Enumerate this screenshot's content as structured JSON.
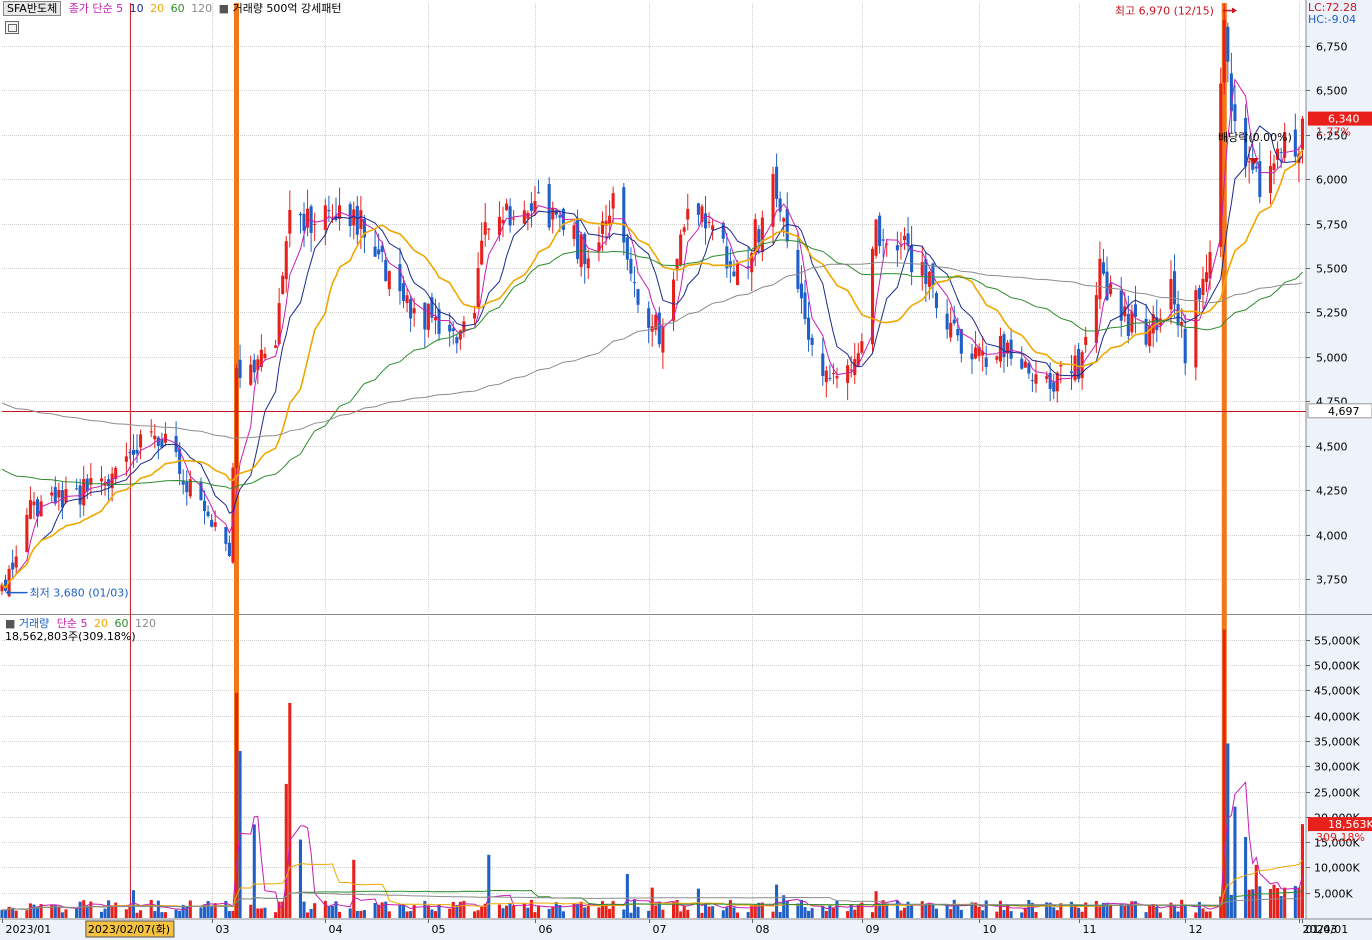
{
  "header": {
    "symbol": "SFA반도체",
    "ma_title": "종가 단순",
    "ma_periods": [
      "5",
      "10",
      "20",
      "60",
      "120"
    ],
    "volume_pattern": "거래량 500억 강세패턴",
    "lc": "LC:72.28",
    "hc": "HC:-9.04"
  },
  "volume_header": {
    "title": "거래량",
    "ma_title": "단순",
    "ma_periods": [
      "5",
      "20",
      "60",
      "120"
    ],
    "readout": "18,562,803주(309.18%)"
  },
  "annotations": {
    "high": "최고 6,970 (12/15)",
    "low": "최저 3,680 (01/03)",
    "dividend": "배당락(0.00%)",
    "last_price": "6,340",
    "last_pct": "1.77%",
    "ref_price": "4,697",
    "last_volume": "18,563K",
    "last_volume_pct": "309.18%",
    "selected_date": "2023/02/07(화)"
  },
  "colors": {
    "up": "#e8201c",
    "down": "#1f5fc8",
    "ma5": "#c81eb4",
    "ma10": "#1c2a8c",
    "ma20": "#f0a800",
    "ma60": "#2e8c2e",
    "ma120": "#8c8c8c",
    "event_bar": "#f07818",
    "ref_line": "#c8141e"
  },
  "chart_data": [
    {
      "type": "candlestick",
      "title": "SFA반도체",
      "x_ticks": [
        {
          "label": "2023/01",
          "date": "2023-01-02"
        },
        {
          "label": "03",
          "date": "2023-03-02"
        },
        {
          "label": "04",
          "date": "2023-04-03"
        },
        {
          "label": "05",
          "date": "2023-05-02"
        },
        {
          "label": "06",
          "date": "2023-06-01"
        },
        {
          "label": "07",
          "date": "2023-07-03"
        },
        {
          "label": "08",
          "date": "2023-08-01"
        },
        {
          "label": "09",
          "date": "2023-09-01"
        },
        {
          "label": "10",
          "date": "2023-10-04"
        },
        {
          "label": "11",
          "date": "2023-11-01"
        },
        {
          "label": "12",
          "date": "2023-12-01"
        },
        {
          "label": "2024/01",
          "date": "2024-01-02"
        },
        {
          "label": "01/03",
          "date": "2024-01-03"
        }
      ],
      "y_ticks": [
        3750,
        4000,
        4250,
        4500,
        4750,
        5000,
        5250,
        5500,
        5750,
        6000,
        6250,
        6500,
        6750
      ],
      "ylim": [
        3560,
        6990
      ],
      "x_range": [
        "2023-01-02",
        "2024-01-04"
      ],
      "series": [
        {
          "name": "종가",
          "close_points": [
            [
              "2023-01-03",
              3700
            ],
            [
              "2023-01-10",
              4150
            ],
            [
              "2023-01-20",
              4220
            ],
            [
              "2023-01-31",
              4280
            ],
            [
              "2023-02-07",
              4460
            ],
            [
              "2023-02-14",
              4610
            ],
            [
              "2023-02-17",
              4510
            ],
            [
              "2023-02-24",
              4280
            ],
            [
              "2023-03-03",
              4080
            ],
            [
              "2023-03-07",
              3940
            ],
            [
              "2023-03-09",
              4920
            ],
            [
              "2023-03-14",
              4880
            ],
            [
              "2023-03-20",
              5150
            ],
            [
              "2023-03-24",
              5920
            ],
            [
              "2023-03-30",
              5720
            ],
            [
              "2023-04-05",
              5880
            ],
            [
              "2023-04-12",
              5780
            ],
            [
              "2023-04-17",
              5600
            ],
            [
              "2023-04-24",
              5280
            ],
            [
              "2023-05-03",
              5200
            ],
            [
              "2023-05-10",
              5080
            ],
            [
              "2023-05-15",
              5300
            ],
            [
              "2023-05-19",
              5820
            ],
            [
              "2023-05-26",
              5780
            ],
            [
              "2023-06-02",
              5850
            ],
            [
              "2023-06-09",
              5760
            ],
            [
              "2023-06-16",
              5560
            ],
            [
              "2023-06-23",
              5920
            ],
            [
              "2023-06-30",
              5300
            ],
            [
              "2023-07-07",
              5100
            ],
            [
              "2023-07-13",
              5760
            ],
            [
              "2023-07-20",
              5820
            ],
            [
              "2023-07-27",
              5420
            ],
            [
              "2023-08-03",
              5720
            ],
            [
              "2023-08-07",
              6050
            ],
            [
              "2023-08-10",
              5700
            ],
            [
              "2023-08-18",
              5000
            ],
            [
              "2023-08-25",
              4900
            ],
            [
              "2023-08-31",
              5000
            ],
            [
              "2023-09-05",
              5720
            ],
            [
              "2023-09-12",
              5650
            ],
            [
              "2023-09-19",
              5440
            ],
            [
              "2023-09-25",
              5150
            ],
            [
              "2023-10-05",
              5000
            ],
            [
              "2023-10-13",
              5050
            ],
            [
              "2023-10-20",
              4900
            ],
            [
              "2023-10-26",
              4860
            ],
            [
              "2023-11-01",
              4960
            ],
            [
              "2023-11-07",
              5500
            ],
            [
              "2023-11-13",
              5230
            ],
            [
              "2023-11-20",
              5120
            ],
            [
              "2023-11-27",
              5380
            ],
            [
              "2023-12-01",
              5030
            ],
            [
              "2023-12-08",
              5630
            ],
            [
              "2023-12-12",
              6800
            ],
            [
              "2023-12-15",
              6300
            ],
            [
              "2023-12-20",
              5950
            ],
            [
              "2023-12-26",
              6000
            ],
            [
              "2023-12-28",
              6230
            ],
            [
              "2024-01-02",
              6050
            ],
            [
              "2024-01-03",
              6340
            ]
          ]
        },
        {
          "name": "5",
          "color_key": "ma5"
        },
        {
          "name": "10",
          "color_key": "ma10"
        },
        {
          "name": "20",
          "color_key": "ma20"
        },
        {
          "name": "60",
          "color_key": "ma60"
        },
        {
          "name": "120",
          "color_key": "ma120"
        }
      ],
      "reference_line": 4697,
      "annotations": [
        {
          "text": "최고 6,970 (12/15)",
          "date": "2023-12-15",
          "value": 6970
        },
        {
          "text": "최저 3,680 (01/03)",
          "date": "2023-01-03",
          "value": 3680
        }
      ],
      "event_markers": [
        "2023-03-09",
        "2023-12-12"
      ],
      "grid": true
    },
    {
      "type": "bar",
      "title": "거래량",
      "y_ticks": [
        5000,
        10000,
        15000,
        20000,
        25000,
        30000,
        35000,
        40000,
        45000,
        50000,
        55000
      ],
      "y_tick_labels": [
        "5,000K",
        "10,000K",
        "15,000K",
        "20,000K",
        "25,000K",
        "30,000K",
        "35,000K",
        "40,000K",
        "45,000K",
        "50,000K",
        "55,000K"
      ],
      "ylim": [
        0,
        58500
      ],
      "y_unit": "K",
      "spikes": [
        [
          "2023-02-08",
          5500
        ],
        [
          "2023-03-09",
          44500
        ],
        [
          "2023-03-10",
          33000
        ],
        [
          "2023-03-14",
          18500
        ],
        [
          "2023-03-23",
          26500
        ],
        [
          "2023-03-24",
          42500
        ],
        [
          "2023-03-27",
          15500
        ],
        [
          "2023-04-11",
          11500
        ],
        [
          "2023-05-19",
          12500
        ],
        [
          "2023-06-27",
          8700
        ],
        [
          "2023-07-04",
          6000
        ],
        [
          "2023-07-17",
          5800
        ],
        [
          "2023-08-08",
          6600
        ],
        [
          "2023-08-10",
          4500
        ],
        [
          "2023-09-05",
          5300
        ],
        [
          "2023-12-12",
          57000
        ],
        [
          "2023-12-13",
          34500
        ],
        [
          "2023-12-15",
          22000
        ],
        [
          "2023-12-18",
          16000
        ],
        [
          "2023-12-21",
          10500
        ],
        [
          "2023-12-29",
          6000
        ],
        [
          "2024-01-03",
          18563
        ]
      ],
      "last_value": 18563,
      "last_value_pct": 309.18
    }
  ]
}
